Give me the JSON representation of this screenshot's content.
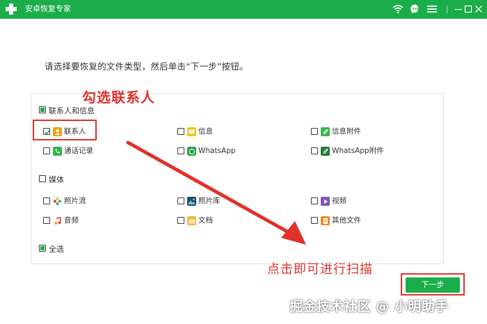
{
  "window": {
    "title": "安卓恢复专家",
    "icons": [
      "plus-logo-icon",
      "wifi-icon",
      "chat-icon",
      "menu-icon",
      "minimize-icon",
      "maximize-icon",
      "close-icon"
    ]
  },
  "instruction": "请选择要恢复的文件类型，然后单击“下一步”按钮。",
  "groups": {
    "contacts_messages": {
      "label": "联系人和信息",
      "state": "partial",
      "items": {
        "contacts": {
          "label": "联系人",
          "checked": true,
          "icon": "contacts-icon"
        },
        "messages": {
          "label": "信息",
          "checked": false,
          "icon": "message-icon"
        },
        "message_attachments": {
          "label": "信息附件",
          "checked": false,
          "icon": "attachment-icon"
        },
        "call_log": {
          "label": "通话记录",
          "checked": false,
          "icon": "phone-icon"
        },
        "whatsapp": {
          "label": "WhatsApp",
          "checked": false,
          "icon": "whatsapp-icon"
        },
        "whatsapp_attachments": {
          "label": "WhatsApp附件",
          "checked": false,
          "icon": "whatsapp-attachment-icon"
        }
      }
    },
    "media": {
      "label": "媒体",
      "state": "unchecked",
      "items": {
        "camera_roll": {
          "label": "照片流",
          "checked": false,
          "icon": "photo-stream-icon"
        },
        "photo_library": {
          "label": "照片库",
          "checked": false,
          "icon": "photo-library-icon"
        },
        "video": {
          "label": "视频",
          "checked": false,
          "icon": "video-icon"
        },
        "audio": {
          "label": "音频",
          "checked": false,
          "icon": "audio-icon"
        },
        "documents": {
          "label": "文档",
          "checked": false,
          "icon": "folder-icon"
        },
        "other_files": {
          "label": "其他文件",
          "checked": false,
          "icon": "file-icon"
        }
      }
    },
    "select_all": {
      "label": "全选",
      "state": "partial"
    }
  },
  "annotations": {
    "select_contacts": "勾选联系人",
    "click_to_scan": "点击即可进行扫描"
  },
  "next_button": {
    "label": "下一步"
  },
  "watermark": "掘金技术社区 @ 小明助手",
  "colors": {
    "accent_green": "#1aad49",
    "annotation_red": "#e0312b"
  }
}
